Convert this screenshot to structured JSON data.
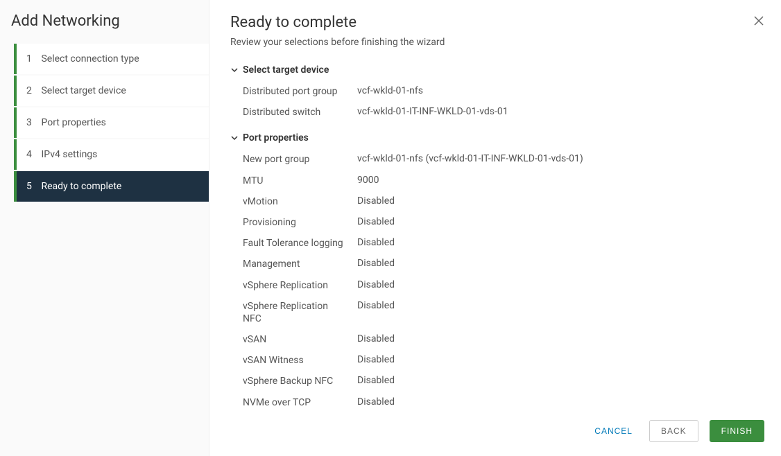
{
  "wizardTitle": "Add Networking",
  "steps": [
    {
      "num": "1",
      "label": "Select connection type",
      "state": "completed"
    },
    {
      "num": "2",
      "label": "Select target device",
      "state": "completed"
    },
    {
      "num": "3",
      "label": "Port properties",
      "state": "completed"
    },
    {
      "num": "4",
      "label": "IPv4 settings",
      "state": "completed"
    },
    {
      "num": "5",
      "label": "Ready to complete",
      "state": "active"
    }
  ],
  "page": {
    "title": "Ready to complete",
    "subtitle": "Review your selections before finishing the wizard"
  },
  "sections": [
    {
      "title": "Select target device",
      "rows": [
        {
          "label": "Distributed port group",
          "value": "vcf-wkld-01-nfs"
        },
        {
          "label": "Distributed switch",
          "value": "vcf-wkld-01-IT-INF-WKLD-01-vds-01"
        }
      ]
    },
    {
      "title": "Port properties",
      "rows": [
        {
          "label": "New port group",
          "value": "vcf-wkld-01-nfs (vcf-wkld-01-IT-INF-WKLD-01-vds-01)"
        },
        {
          "label": "MTU",
          "value": "9000"
        },
        {
          "label": "vMotion",
          "value": "Disabled"
        },
        {
          "label": "Provisioning",
          "value": "Disabled"
        },
        {
          "label": "Fault Tolerance logging",
          "value": "Disabled"
        },
        {
          "label": "Management",
          "value": "Disabled"
        },
        {
          "label": "vSphere Replication",
          "value": "Disabled"
        },
        {
          "label": "vSphere Replication NFC",
          "value": "Disabled"
        },
        {
          "label": "vSAN",
          "value": "Disabled"
        },
        {
          "label": "vSAN Witness",
          "value": "Disabled"
        },
        {
          "label": "vSphere Backup NFC",
          "value": "Disabled"
        },
        {
          "label": "NVMe over TCP",
          "value": "Disabled"
        }
      ]
    }
  ],
  "footer": {
    "cancel": "CANCEL",
    "back": "BACK",
    "finish": "FINISH"
  }
}
